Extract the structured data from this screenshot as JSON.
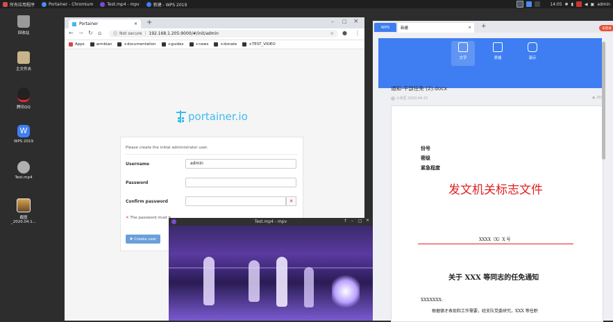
{
  "taskbar": {
    "items": [
      {
        "label": "所有应用程序",
        "color": "#d94b4b"
      },
      {
        "label": "Portainer - Chromium",
        "color": "#4c8bf5"
      },
      {
        "label": "Test.mp4 - mpv",
        "color": "#7b4bd9"
      },
      {
        "label": "新建 - WPS 2019",
        "color": "#3f7ef2"
      }
    ],
    "clock": "14:05",
    "user": "admin"
  },
  "desktop": {
    "icons": [
      {
        "label": "回收站",
        "color": "#9a9a9a"
      },
      {
        "label": "主文件夹",
        "color": "#c8b48a"
      },
      {
        "label": "腾讯QQ",
        "color": "#222222"
      },
      {
        "label": "WPS 2019",
        "color": "#3f7ef2"
      },
      {
        "label": "Test.mp4",
        "color": "#b0b0b0"
      },
      {
        "label": "截图_2020.04.1...",
        "color": "#d8a24a"
      }
    ]
  },
  "chrome": {
    "tab_title": "Portainer",
    "security": "Not secure",
    "url": "192.168.1.205:9000/#/init/admin",
    "bookmarks": [
      "Apps",
      "armbian",
      "+documentation",
      "+guides",
      "+news",
      "+donate",
      "+TEST_VIDEO"
    ]
  },
  "portainer": {
    "logo_text": "portainer.io",
    "intro": "Please create the initial administrator user.",
    "username_label": "Username",
    "username_value": "admin",
    "password_label": "Password",
    "confirm_label": "Confirm password",
    "mismatch_msg": "The password must b",
    "create_button": "Create user"
  },
  "mpv": {
    "title": "Test.mp4 - mpv"
  },
  "wps": {
    "tab_app": "WPS",
    "tab_doc": "新建",
    "badge": "未登录",
    "ribbon": [
      {
        "label": "文字"
      },
      {
        "label": "表格"
      },
      {
        "label": "演示"
      }
    ],
    "doc_title": "通知-干部任免 (2).docx",
    "doc_author": "小未匠  2020-04-15",
    "doc_views": "265",
    "doc_fields": [
      "份号",
      "密级",
      "紧急程度"
    ],
    "doc_heading": "发文机关标志文件",
    "doc_number": "XXXX〔X〕X 号",
    "doc_subject": "关于 XXX 等同志的任免通知",
    "doc_salutation": "XXXXXXX:",
    "doc_body": "根据德才表现和工作需要，经支队党委研究，XXX 等任职"
  }
}
